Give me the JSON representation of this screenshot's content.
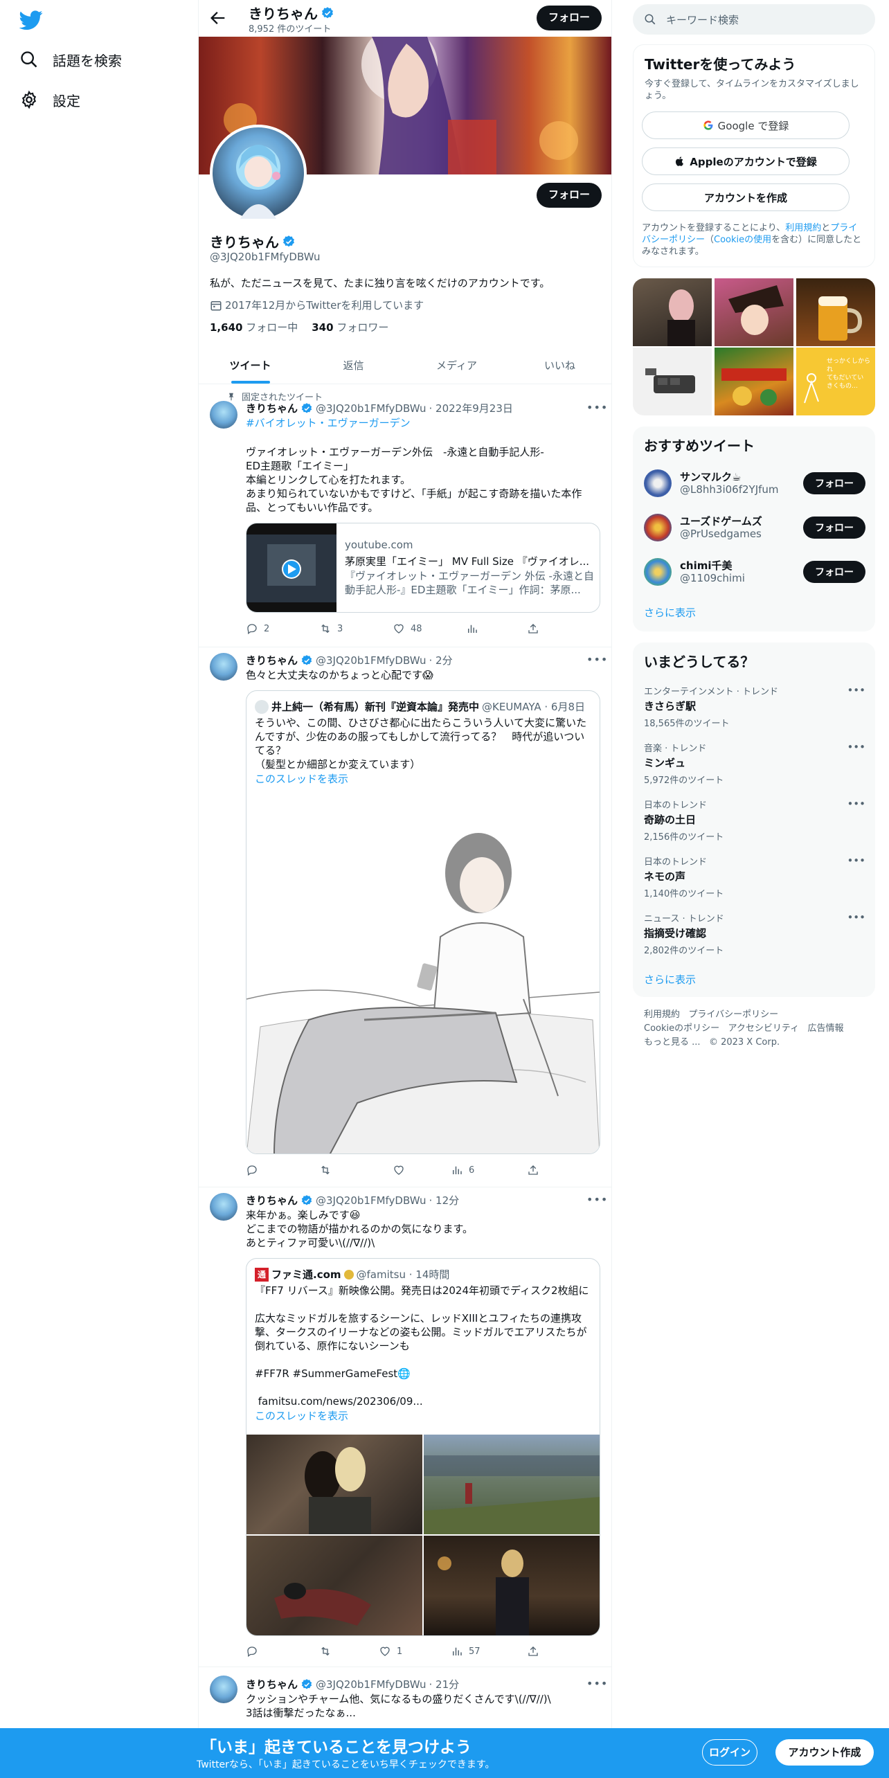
{
  "nav": {
    "explore_label": "話題を検索",
    "settings_label": "設定"
  },
  "header": {
    "name": "きりちゃん",
    "tweet_count": "8,952 件のツイート",
    "follow_label": "フォロー"
  },
  "profile": {
    "name": "きりちゃん",
    "handle": "@3JQ20b1FMfyDBWu",
    "bio": "私が、ただニュースを見て、たまに独り言を呟くだけのアカウントです。",
    "joined": "2017年12月からTwitterを利用しています",
    "following_count": "1,640",
    "following_label": "フォロー中",
    "followers_count": "340",
    "followers_label": "フォロワー",
    "follow_label": "フォロー"
  },
  "tabs": [
    "ツイート",
    "返信",
    "メディア",
    "いいね"
  ],
  "tweets": [
    {
      "pinned_label": "固定されたツイート",
      "name": "きりちゃん",
      "handle": "@3JQ20b1FMfyDBWu",
      "time": "· 2022年9月23日",
      "hashtag": "#バイオレット・エヴァーガーデン",
      "text": "ヴァイオレット・エヴァーガーデン外伝　-永遠と自動手記人形-\nED主題歌「エイミー」\n本編とリンクして心を打たれます。\nあまり知られていないかもですけど、「手紙」が起こす奇跡を描いた本作品、とってもいい作品です。",
      "card_domain": "youtube.com",
      "card_title": "茅原実里「エイミー」 MV Full Size 『ヴァイオレ...",
      "card_desc": "『ヴァイオレット・エヴァーガーデン 外伝 -永遠と自動手記人形-』ED主題歌「エイミー」作詞：茅原...",
      "replies": "2",
      "retweets": "3",
      "likes": "48",
      "views": ""
    },
    {
      "name": "きりちゃん",
      "handle": "@3JQ20b1FMfyDBWu",
      "time": "· 2分",
      "text": "色々と大丈夫なのかちょっと心配です😱",
      "quote_name": "井上純一（希有馬）新刊『逆資本論』発売中",
      "quote_handle": "@KEUMAYA · 6月8日",
      "quote_text": "そういや、この間、ひさびさ都心に出たらこういう人いて大変に驚いたんですが、少佐のあの服ってもしかして流行ってる？　時代が追いついてる？\n（髪型とか細部とか変えています）",
      "show_thread": "このスレッドを表示",
      "replies": "",
      "retweets": "",
      "likes": "",
      "views": "6"
    },
    {
      "name": "きりちゃん",
      "handle": "@3JQ20b1FMfyDBWu",
      "time": "· 12分",
      "text": "来年かぁ。楽しみです😆\nどこまでの物語が描かれるのかの気になります。\nあとティファ可愛い\\(//∇//)\\",
      "quote_badge": "通",
      "quote_name": "ファミ通.com",
      "quote_handle": "@famitsu · 14時間",
      "quote_text": "『FF7 リバース』新映像公開。発売日は2024年初頭でディスク2枚組に\n\n広大なミッドガルを旅するシーンに、レッドXIIIとユフィたちの連携攻撃、タークスのイリーナなどの姿も公開。ミッドガルでエアリスたちが倒れている、原作にないシーンも\n\n#FF7R #SummerGameFest🌐\n\n famitsu.com/news/202306/09...",
      "show_thread": "このスレッドを表示",
      "replies": "",
      "retweets": "",
      "likes": "1",
      "views": "57"
    },
    {
      "name": "きりちゃん",
      "handle": "@3JQ20b1FMfyDBWu",
      "time": "· 21分",
      "text": "クッションやチャーム他、気になるもの盛りだくさんです\\(//∇//)\\\n3話は衝撃だったなぁ..."
    }
  ],
  "right": {
    "search_placeholder": "キーワード検索",
    "signup": {
      "title": "Twitterを使ってみよう",
      "subtitle": "今すぐ登録して、タイムラインをカスタマイズしましょう。",
      "google": "Google で登録",
      "apple": "Appleのアカウントで登録",
      "create": "アカウントを作成",
      "terms_prefix": "アカウントを登録することにより、",
      "terms_link": "利用規約",
      "terms_and": "と",
      "privacy_link": "プライバシーポリシー",
      "paren_open": "（",
      "cookie_link": "Cookieの使用",
      "terms_suffix": "を含む）に同意したとみなされます。"
    },
    "recommend": {
      "title": "おすすめツイート",
      "users": [
        {
          "name": "サンマルク☕",
          "handle": "@L8hh3i06f2YJfum",
          "color": "#3d5fa8"
        },
        {
          "name": "ユーズドゲームズ",
          "handle": "@PrUsedgames",
          "color": "#c0392b"
        },
        {
          "name": "chimi千美",
          "handle": "@1109chimi",
          "color": "#3a8ad8"
        }
      ],
      "follow_label": "フォロー",
      "more": "さらに表示"
    },
    "trends": {
      "title": "いまどうしてる？",
      "items": [
        {
          "category": "エンターテインメント · トレンド",
          "title": "きさらぎ駅",
          "count": "18,565件のツイート"
        },
        {
          "category": "音楽 · トレンド",
          "title": "ミンギュ",
          "count": "5,972件のツイート"
        },
        {
          "category": "日本のトレンド",
          "title": "奇跡の土日",
          "count": "2,156件のツイート"
        },
        {
          "category": "日本のトレンド",
          "title": "ネモの声",
          "count": "1,140件のツイート"
        },
        {
          "category": "ニュース · トレンド",
          "title": "指摘受け確認",
          "count": "2,802件のツイート"
        }
      ],
      "more": "さらに表示"
    },
    "footer": {
      "terms": "利用規約",
      "privacy": "プライバシーポリシー",
      "cookie": "Cookieのポリシー",
      "access": "アクセシビリティ",
      "ads": "広告情報",
      "more": "もっと見る ...",
      "copyright": "© 2023 X Corp."
    },
    "media_text": "せっかくしかられ\nてもだいてい\nきくもの…"
  },
  "bottom": {
    "title": "「いま」起きていることを見つけよう",
    "subtitle": "Twitterなら、「いま」起きていることをいち早くチェックできます。",
    "login": "ログイン",
    "signup": "アカウント作成"
  },
  "colors": {
    "accent": "#1d9bf0",
    "text": "#0f1419",
    "muted": "#536471"
  }
}
